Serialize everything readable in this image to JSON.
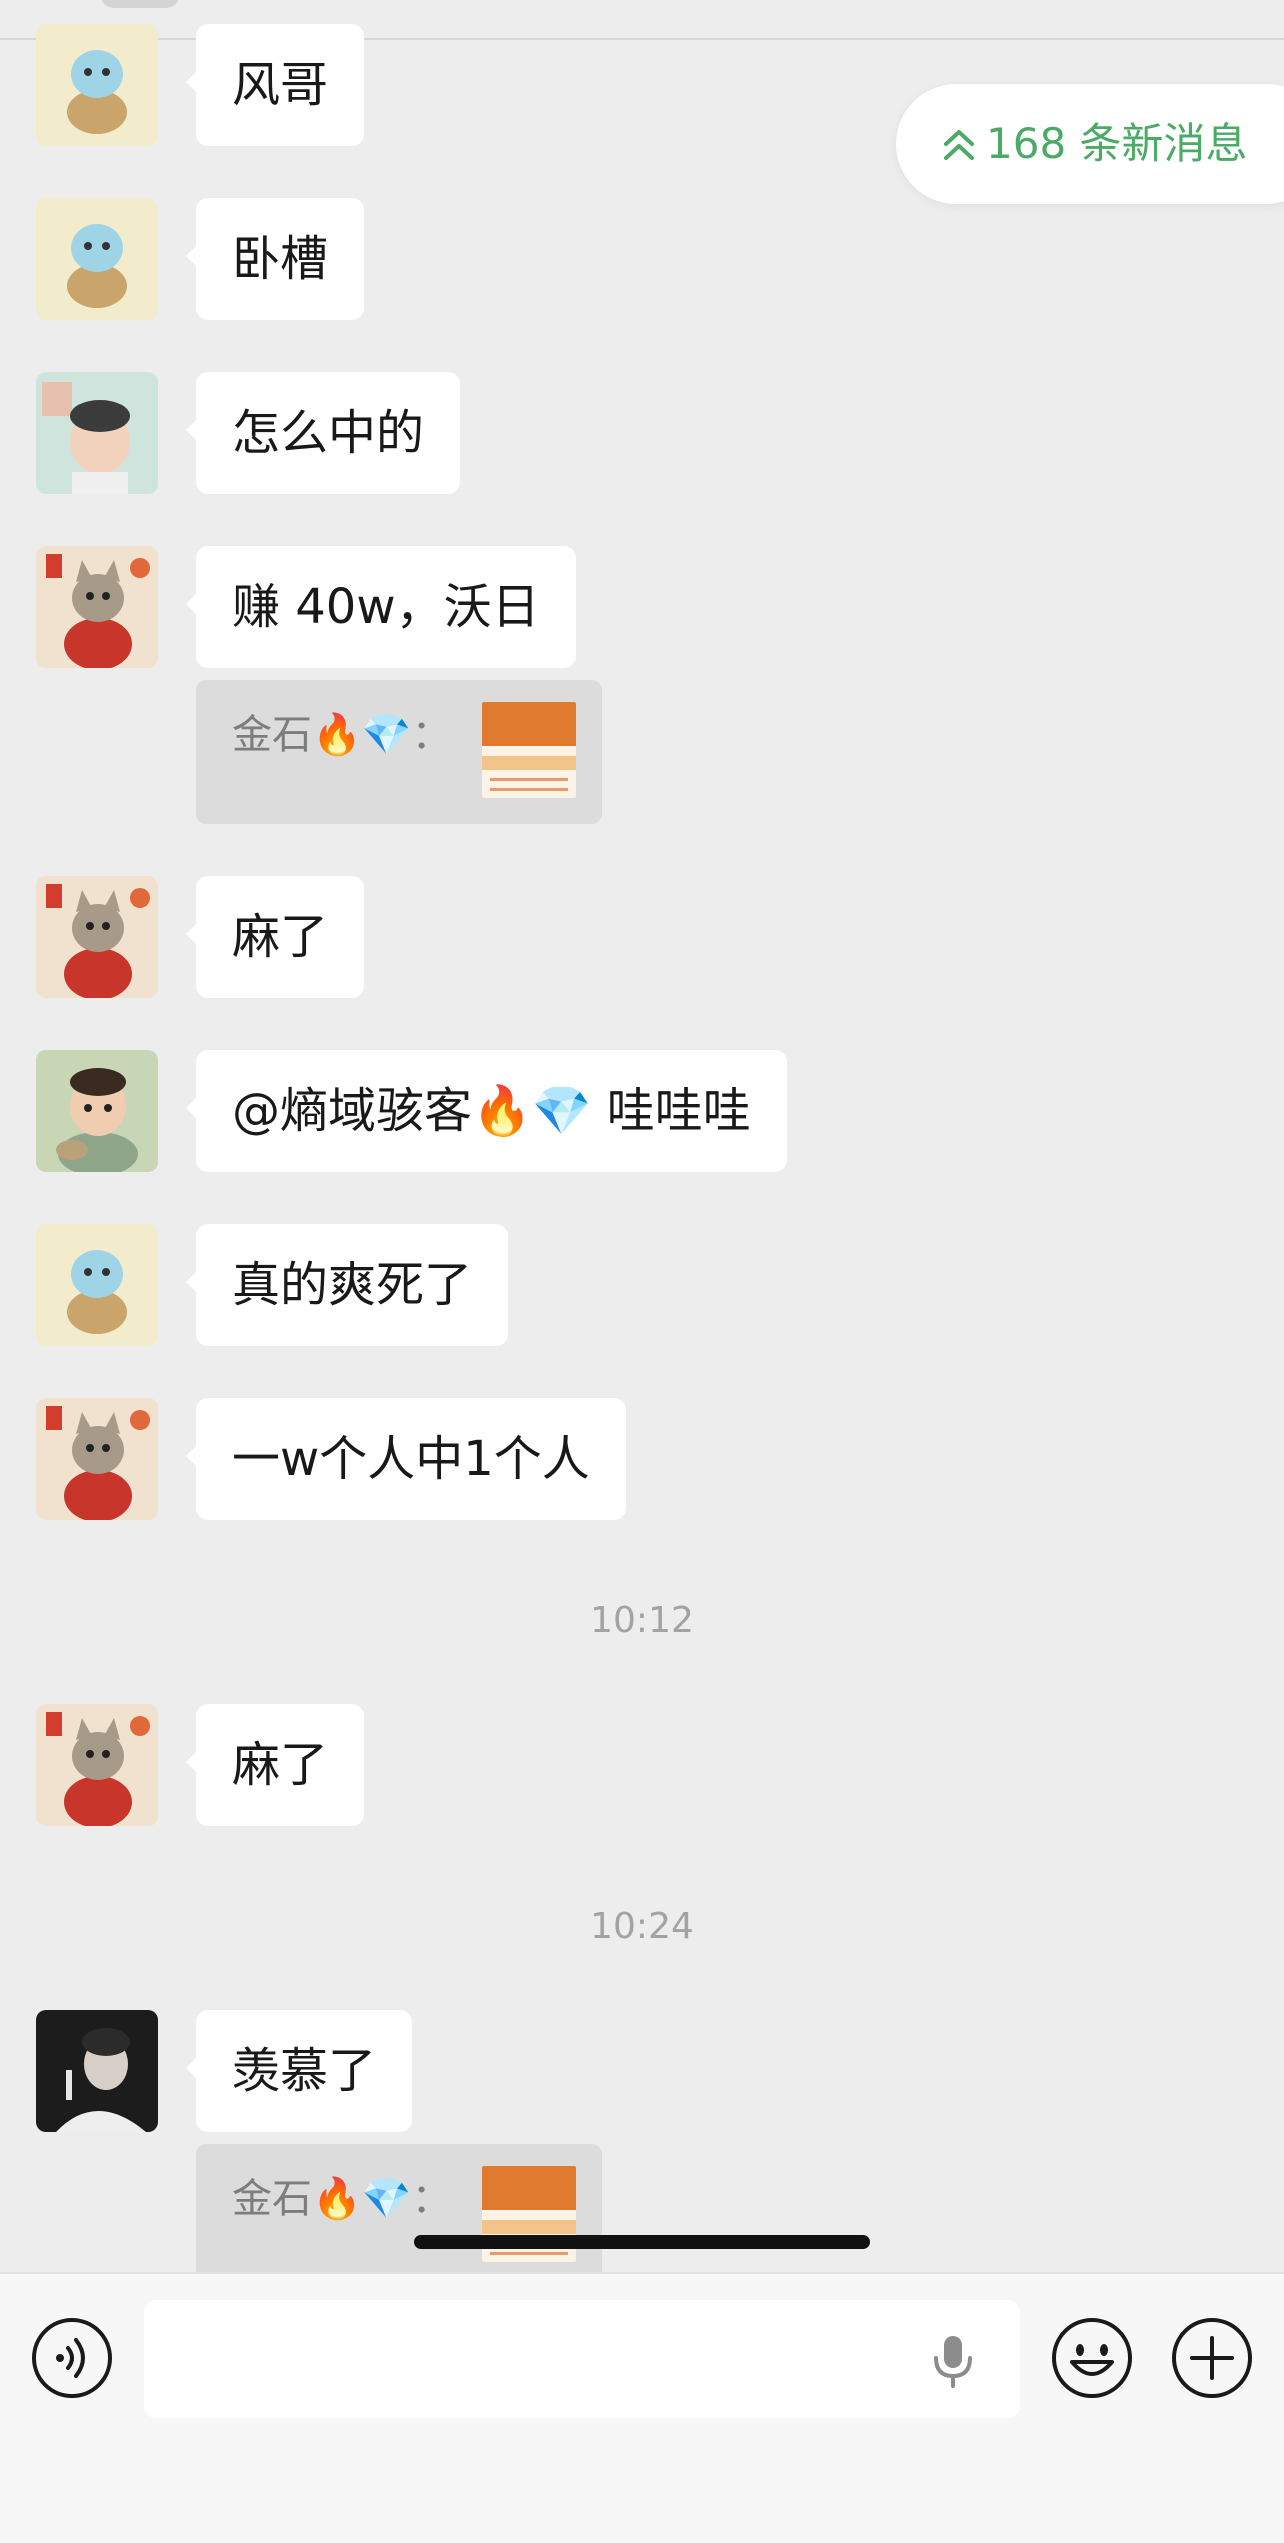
{
  "new_messages": {
    "label": "168 条新消息"
  },
  "messages": [
    {
      "avatar": "squirtle-avatar",
      "text": "风哥"
    },
    {
      "avatar": "squirtle-avatar",
      "text": "卧槽"
    },
    {
      "avatar": "baby-avatar",
      "text": "怎么中的"
    },
    {
      "avatar": "cat-red-sweater-avatar",
      "text": "赚 40w，沃日",
      "quote": "金石🔥💎："
    },
    {
      "avatar": "cat-red-sweater-avatar",
      "text": "麻了"
    },
    {
      "avatar": "cartoon-kid-avatar",
      "text": "@熵域骇客🔥💎 哇哇哇"
    },
    {
      "avatar": "squirtle-avatar",
      "text": "真的爽死了"
    },
    {
      "avatar": "cat-red-sweater-avatar",
      "text": "一w个人中1个人"
    },
    {
      "time": "10:12"
    },
    {
      "avatar": "cat-red-sweater-avatar",
      "text": "麻了"
    },
    {
      "time": "10:24"
    },
    {
      "avatar": "dark-portrait-avatar",
      "text": "羡慕了",
      "quote": "金石🔥💎："
    }
  ],
  "input": {
    "placeholder": ""
  },
  "icons": {
    "voice": "voice-icon",
    "microphone": "microphone-icon",
    "emoji": "emoji-icon",
    "plus": "plus-icon"
  },
  "colors": {
    "background": "#ededed",
    "bubble": "#ffffff",
    "accent_green": "#4caa67"
  }
}
